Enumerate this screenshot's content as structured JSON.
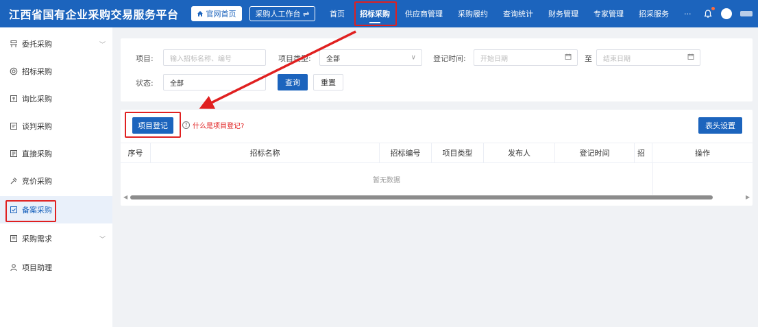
{
  "header": {
    "brand": "江西省国有企业采购交易服务平台",
    "home_button": "官网首页",
    "workbench_button": "采购人工作台 ⇌",
    "nav": [
      "首页",
      "招标采购",
      "供应商管理",
      "采购履约",
      "查询统计",
      "财务管理",
      "专家管理",
      "招采服务",
      "···"
    ],
    "active_nav_index": 1
  },
  "sidebar": {
    "items": [
      {
        "label": "委托采购",
        "icon": "delegate-icon",
        "chevron": "﹀"
      },
      {
        "label": "招标采购",
        "icon": "tender-icon"
      },
      {
        "label": "询比采购",
        "icon": "inquiry-icon"
      },
      {
        "label": "谈判采购",
        "icon": "negotiation-icon"
      },
      {
        "label": "直接采购",
        "icon": "direct-icon"
      },
      {
        "label": "竞价采购",
        "icon": "bidding-icon"
      },
      {
        "label": "备案采购",
        "icon": "filing-icon"
      },
      {
        "label": "采购需求",
        "icon": "demand-icon",
        "chevron": "﹀"
      },
      {
        "label": "项目助理",
        "icon": "assistant-icon"
      }
    ],
    "active_index": 6
  },
  "search": {
    "project_label": "项目:",
    "project_placeholder": "输入招标名称、编号",
    "type_label": "项目类型:",
    "type_value": "全部",
    "date_label": "登记时间:",
    "start_placeholder": "开始日期",
    "to_label": "至",
    "end_placeholder": "结束日期",
    "status_label": "状态:",
    "status_value": "全部",
    "query_button": "查询",
    "reset_button": "重置"
  },
  "table": {
    "register_button": "项目登记",
    "help_link": "什么是项目登记?",
    "header_settings_button": "表头设置",
    "columns": [
      "序号",
      "招标名称",
      "招标编号",
      "项目类型",
      "发布人",
      "登记时间",
      "招",
      "操作"
    ],
    "empty_text": "暂无数据"
  },
  "colors": {
    "primary": "#1c64bd",
    "highlight_red": "#e02020",
    "notification_dot": "#ff6b3b"
  }
}
